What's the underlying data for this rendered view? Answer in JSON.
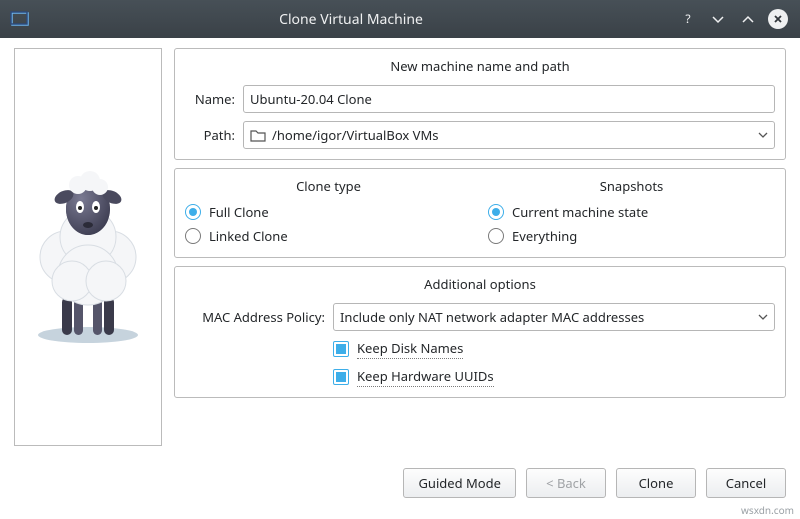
{
  "window": {
    "title": "Clone Virtual Machine"
  },
  "group1": {
    "title": "New machine name and path",
    "name_label": "Name:",
    "name_value": "Ubuntu-20.04 Clone",
    "path_label": "Path:",
    "path_value": "/home/igor/VirtualBox VMs"
  },
  "group2": {
    "clone_title": "Clone type",
    "full_clone": "Full Clone",
    "linked_clone": "Linked Clone",
    "snapshots_title": "Snapshots",
    "current_state": "Current machine state",
    "everything": "Everything"
  },
  "group3": {
    "title": "Additional options",
    "mac_label": "MAC Address Policy:",
    "mac_value": "Include only NAT network adapter MAC addresses",
    "keep_disk": "Keep Disk Names",
    "keep_uuid": "Keep Hardware UUIDs"
  },
  "buttons": {
    "guided": "Guided Mode",
    "back": "< Back",
    "clone": "Clone",
    "cancel": "Cancel"
  },
  "watermark": "wsxdn.com"
}
